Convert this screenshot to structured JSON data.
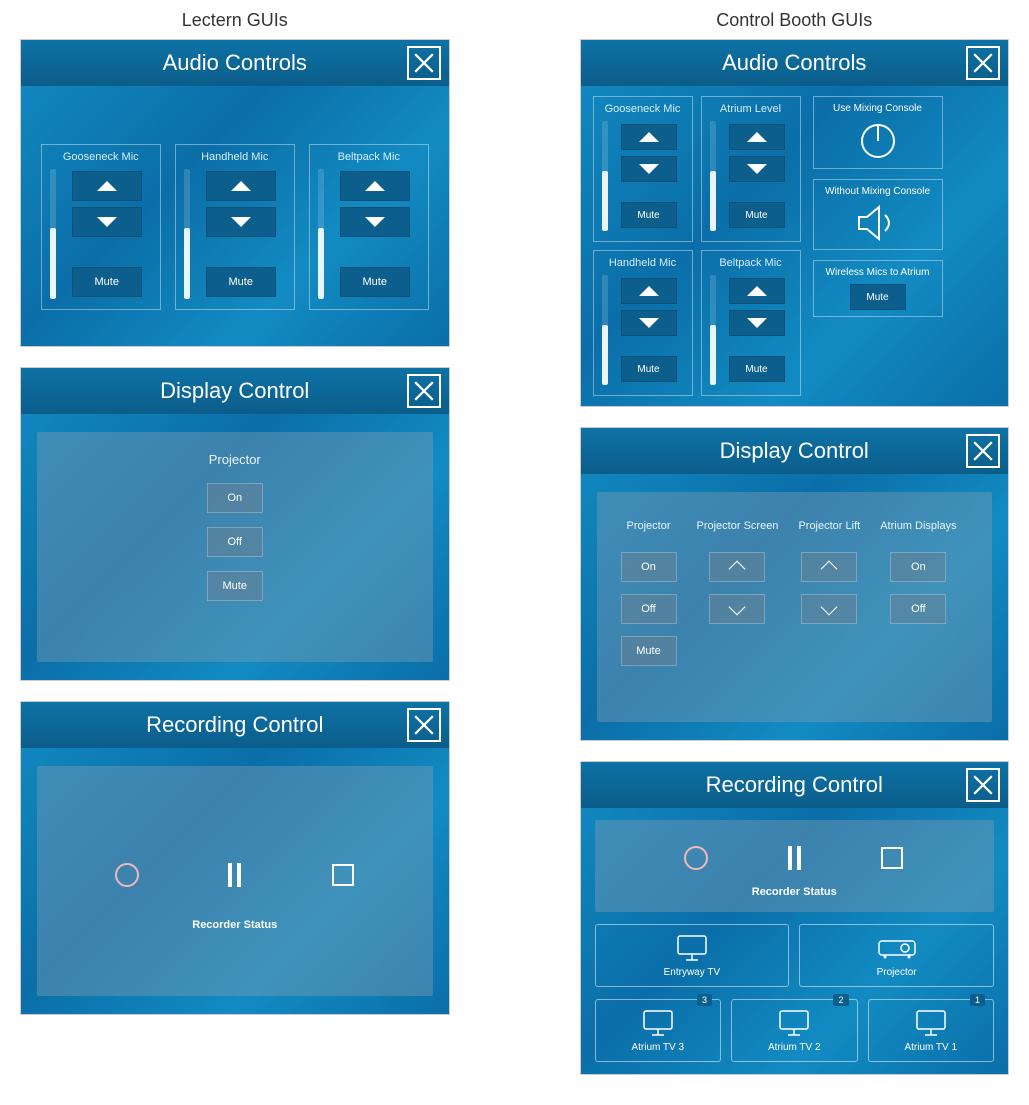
{
  "columns": {
    "left_title": "Lectern GUIs",
    "right_title": "Control Booth GUIs"
  },
  "lectern": {
    "audio": {
      "title": "Audio Controls",
      "mics": [
        {
          "label": "Gooseneck Mic",
          "mute": "Mute"
        },
        {
          "label": "Handheld Mic",
          "mute": "Mute"
        },
        {
          "label": "Beltpack Mic",
          "mute": "Mute"
        }
      ]
    },
    "display": {
      "title": "Display Control",
      "projector_label": "Projector",
      "on": "On",
      "off": "Off",
      "mute": "Mute"
    },
    "recording": {
      "title": "Recording Control",
      "status": "Recorder Status"
    }
  },
  "booth": {
    "audio": {
      "title": "Audio Controls",
      "mics": [
        {
          "label": "Gooseneck Mic",
          "mute": "Mute"
        },
        {
          "label": "Atrium Level",
          "mute": "Mute"
        },
        {
          "label": "Handheld Mic",
          "mute": "Mute"
        },
        {
          "label": "Beltpack Mic",
          "mute": "Mute"
        }
      ],
      "use_mixer": "Use Mixing Console",
      "without_mixer": "Without Mixing Console",
      "wireless_label": "Wireless Mics to Atrium",
      "wireless_mute": "Mute"
    },
    "display": {
      "title": "Display Control",
      "cols": [
        {
          "hdr": "Projector",
          "b1": "On",
          "b2": "Off"
        },
        {
          "hdr": "Projector Screen",
          "b1": "up",
          "b2": "down"
        },
        {
          "hdr": "Projector Lift",
          "b1": "up",
          "b2": "down"
        },
        {
          "hdr": "Atrium Displays",
          "b1": "On",
          "b2": "Off"
        }
      ],
      "mute": "Mute"
    },
    "recording": {
      "title": "Recording Control",
      "status": "Recorder Status",
      "row1": [
        {
          "label": "Entryway TV"
        },
        {
          "label": "Projector"
        }
      ],
      "row2": [
        {
          "label": "Atrium TV 3",
          "badge": "3"
        },
        {
          "label": "Atrium TV 2",
          "badge": "2"
        },
        {
          "label": "Atrium TV 1",
          "badge": "1"
        }
      ]
    }
  }
}
